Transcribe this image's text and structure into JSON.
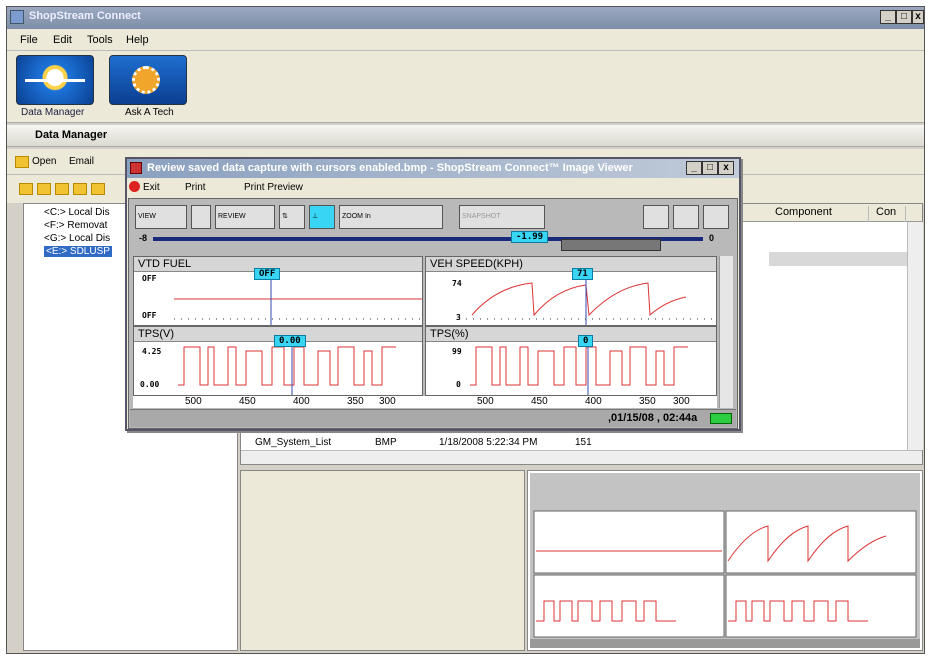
{
  "app": {
    "title": "ShopStream Connect"
  },
  "menu": [
    "File",
    "Edit",
    "Tools",
    "Help"
  ],
  "launcher": {
    "items": [
      {
        "label": "Data Manager"
      },
      {
        "label": "Ask A Tech"
      }
    ]
  },
  "data_manager": {
    "title": "Data Manager"
  },
  "toolbar": {
    "open": "Open",
    "email": "Email"
  },
  "tree": {
    "items": [
      "<C:> Local Dis",
      "<F:> Removat",
      "<G:> Local Dis",
      "<E:> SDLUSP"
    ]
  },
  "filelist": {
    "columns": [
      "Component",
      "Con"
    ],
    "row": {
      "name": "GM_System_List",
      "type": "BMP",
      "date": "1/18/2008 5:22:34 PM",
      "size": "151"
    }
  },
  "viewer": {
    "title": "Review saved data capture with cursors enabled.bmp - ShopStream Connect™ Image Viewer",
    "toolbar": {
      "exit": "Exit",
      "print": "Print",
      "print_preview": "Print Preview"
    },
    "scope_buttons": {
      "view": "VIEW",
      "review": "REVIEW",
      "zoom": "ZOOM In",
      "snapshot": "SNAPSHOT"
    },
    "slider": {
      "min": "-8",
      "value": "-1.99",
      "max": "0"
    },
    "graphs": [
      {
        "title": "VTD FUEL",
        "cursor": "OFF",
        "ytop": "OFF",
        "ybot": "OFF"
      },
      {
        "title": "VEH SPEED(KPH)",
        "cursor": "71",
        "ytop": "74",
        "ybot": "3"
      },
      {
        "title": "TPS(V)",
        "cursor": "0.00",
        "ytop": "4.25",
        "ybot": "0.00"
      },
      {
        "title": "TPS(%)",
        "cursor": "0",
        "ytop": "99",
        "ybot": "0"
      }
    ],
    "xaxis": [
      "500",
      "450",
      "400",
      "350",
      "300"
    ],
    "status": ",01/15/08 , 02:44a"
  }
}
